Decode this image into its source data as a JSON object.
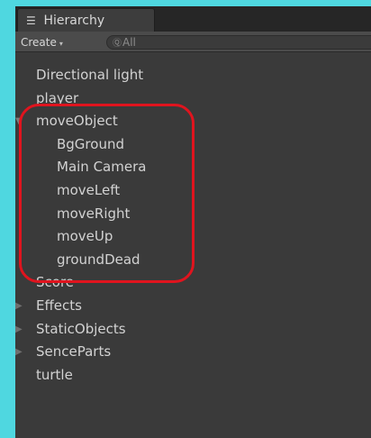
{
  "panel": {
    "tab_icon": "hierarchy-list-icon",
    "tab_icon_glyph": "☰",
    "tab_title": "Hierarchy"
  },
  "toolbar": {
    "create_label": "Create",
    "create_arrow": "▾",
    "search_icon_glyph": "Ⓠ",
    "search_placeholder": "All"
  },
  "tree": {
    "items": [
      {
        "label": "Directional light",
        "level": 0,
        "expand": "none"
      },
      {
        "label": "player",
        "level": 0,
        "expand": "none"
      },
      {
        "label": "moveObject",
        "level": 0,
        "expand": "open"
      },
      {
        "label": "BgGround",
        "level": 1,
        "expand": "none"
      },
      {
        "label": "Main Camera",
        "level": 1,
        "expand": "none"
      },
      {
        "label": "moveLeft",
        "level": 1,
        "expand": "none"
      },
      {
        "label": "moveRight",
        "level": 1,
        "expand": "none"
      },
      {
        "label": "moveUp",
        "level": 1,
        "expand": "none"
      },
      {
        "label": "groundDead",
        "level": 1,
        "expand": "none"
      },
      {
        "label": "Score",
        "level": 0,
        "expand": "none"
      },
      {
        "label": "Effects",
        "level": 0,
        "expand": "closed"
      },
      {
        "label": "StaticObjects",
        "level": 0,
        "expand": "closed"
      },
      {
        "label": "SenceParts",
        "level": 0,
        "expand": "closed"
      },
      {
        "label": "turtle",
        "level": 0,
        "expand": "none"
      }
    ]
  },
  "annotation": {
    "color": "#e0141e"
  }
}
